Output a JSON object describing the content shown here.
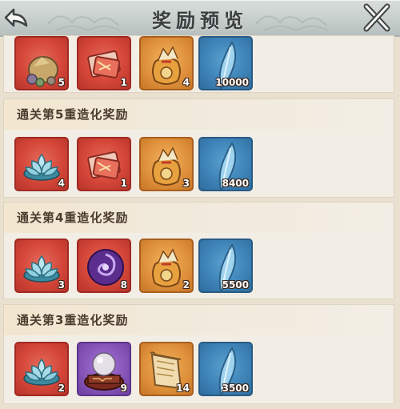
{
  "header": {
    "title": "奖励预览",
    "back_icon": "back-arrow-icon",
    "close_icon": "close-icon"
  },
  "top_row": {
    "items": [
      {
        "icon": "ore-stones-icon",
        "bg": "red",
        "qty": "5"
      },
      {
        "icon": "red-scroll-bundle-icon",
        "bg": "red",
        "qty": "1"
      },
      {
        "icon": "lucky-bag-icon",
        "bg": "gold",
        "qty": "4"
      },
      {
        "icon": "blue-crystal-feather-icon",
        "bg": "blue",
        "qty": "10000"
      }
    ]
  },
  "sections": [
    {
      "title": "通关第5重造化奖励",
      "items": [
        {
          "icon": "lotus-icon",
          "bg": "red",
          "qty": "4"
        },
        {
          "icon": "red-scroll-bundle-icon",
          "bg": "red",
          "qty": "1"
        },
        {
          "icon": "lucky-bag-icon",
          "bg": "gold",
          "qty": "3"
        },
        {
          "icon": "blue-crystal-feather-icon",
          "bg": "blue",
          "qty": "8400"
        }
      ]
    },
    {
      "title": "通关第4重造化奖励",
      "items": [
        {
          "icon": "lotus-icon",
          "bg": "red",
          "qty": "3"
        },
        {
          "icon": "purple-swirl-orb-icon",
          "bg": "red",
          "qty": "8"
        },
        {
          "icon": "lucky-bag-icon",
          "bg": "gold",
          "qty": "2"
        },
        {
          "icon": "blue-crystal-feather-icon",
          "bg": "blue",
          "qty": "5500"
        }
      ]
    },
    {
      "title": "通关第3重造化奖励",
      "items": [
        {
          "icon": "lotus-icon",
          "bg": "red",
          "qty": "2"
        },
        {
          "icon": "pearl-on-stand-icon",
          "bg": "purple",
          "qty": "9"
        },
        {
          "icon": "parchment-scroll-icon",
          "bg": "gold",
          "qty": "14"
        },
        {
          "icon": "blue-crystal-feather-icon",
          "bg": "blue",
          "qty": "3500"
        }
      ]
    }
  ]
}
